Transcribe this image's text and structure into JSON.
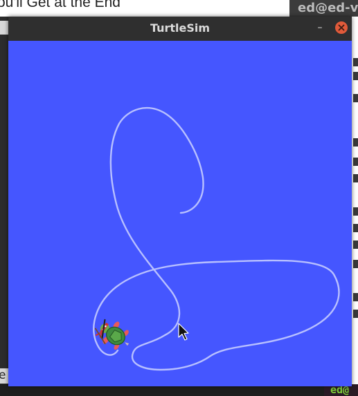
{
  "window": {
    "title": "TurtleSim",
    "minimize_label": "–",
    "background_color": "#4556ff",
    "trail_color": "#b8c0ff"
  },
  "background": {
    "document_text": "ou'll Get at the End",
    "terminal_title": "ed@ed-vr",
    "left_fragment": "e",
    "prompt_fragment": "ed@"
  },
  "turtle": {
    "icon": "turtle-icon"
  },
  "cursor": {
    "icon": "mouse-pointer-icon"
  }
}
